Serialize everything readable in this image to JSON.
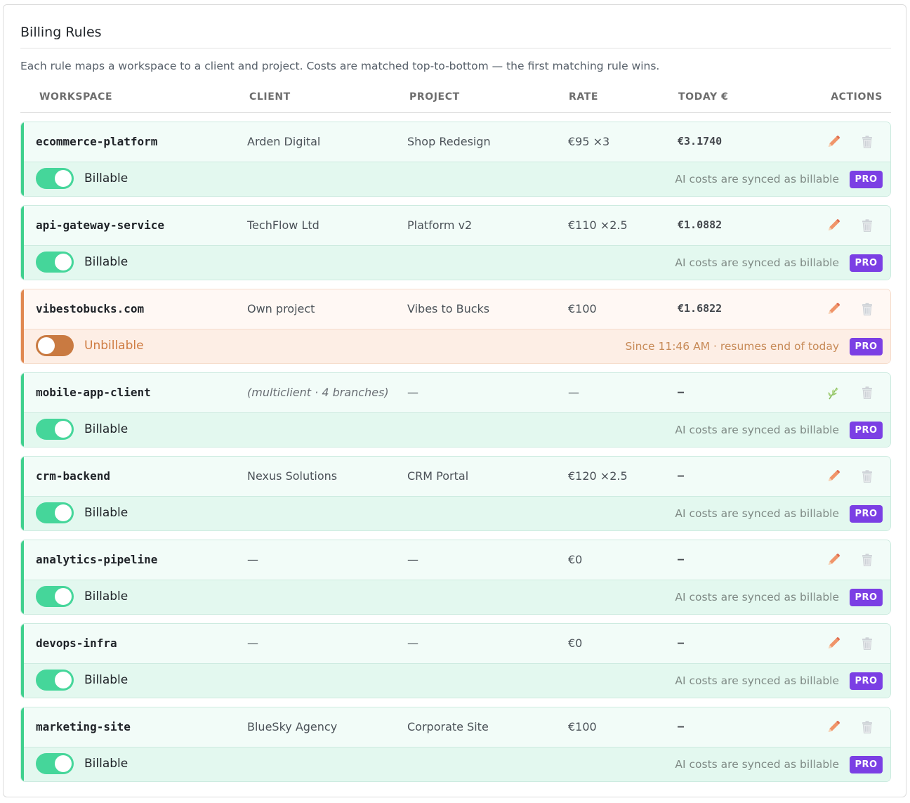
{
  "header": {
    "title": "Billing Rules",
    "description": "Each rule maps a workspace to a client and project. Costs are matched top-to-bottom — the first matching rule wins."
  },
  "columns": {
    "workspace": "WORKSPACE",
    "client": "CLIENT",
    "project": "PROJECT",
    "rate": "RATE",
    "today": "TODAY €",
    "actions": "ACTIONS"
  },
  "colors": {
    "billable_accent": "#3fd08d",
    "unbillable_accent": "#e08850",
    "pro_badge": "#7b3fe4",
    "edit_icon": "#f0956a"
  },
  "rules": [
    {
      "workspace": "ecommerce-platform",
      "client": "Arden Digital",
      "project": "Shop Redesign",
      "rate": "€95 ×3",
      "today": "€3.1740",
      "billable": true,
      "state_label": "Billable",
      "note": "AI costs are synced as billable",
      "badge": "PRO",
      "edit_icon": "pencil-icon",
      "delete_icon": "trash-icon"
    },
    {
      "workspace": "api-gateway-service",
      "client": "TechFlow Ltd",
      "project": "Platform v2",
      "rate": "€110 ×2.5",
      "today": "€1.0882",
      "billable": true,
      "state_label": "Billable",
      "note": "AI costs are synced as billable",
      "badge": "PRO",
      "edit_icon": "pencil-icon",
      "delete_icon": "trash-icon"
    },
    {
      "workspace": "vibestobucks.com",
      "client": "Own project",
      "project": "Vibes to Bucks",
      "rate": "€100",
      "today": "€1.6822",
      "billable": false,
      "state_label": "Unbillable",
      "note": "Since 11:46 AM · resumes end of today",
      "badge": "PRO",
      "edit_icon": "pencil-icon",
      "delete_icon": "trash-icon"
    },
    {
      "workspace": "mobile-app-client",
      "client": "(multiclient · 4 branches)",
      "project": "—",
      "rate": "—",
      "today": "–",
      "billable": true,
      "state_label": "Billable",
      "note": "AI costs are synced as billable",
      "badge": "PRO",
      "edit_icon": "branch-icon",
      "delete_icon": "trash-icon"
    },
    {
      "workspace": "crm-backend",
      "client": "Nexus Solutions",
      "project": "CRM Portal",
      "rate": "€120 ×2.5",
      "today": "–",
      "billable": true,
      "state_label": "Billable",
      "note": "AI costs are synced as billable",
      "badge": "PRO",
      "edit_icon": "pencil-icon",
      "delete_icon": "trash-icon"
    },
    {
      "workspace": "analytics-pipeline",
      "client": "—",
      "project": "—",
      "rate": "€0",
      "today": "–",
      "billable": true,
      "state_label": "Billable",
      "note": "AI costs are synced as billable",
      "badge": "PRO",
      "edit_icon": "pencil-icon",
      "delete_icon": "trash-icon"
    },
    {
      "workspace": "devops-infra",
      "client": "—",
      "project": "—",
      "rate": "€0",
      "today": "–",
      "billable": true,
      "state_label": "Billable",
      "note": "AI costs are synced as billable",
      "badge": "PRO",
      "edit_icon": "pencil-icon",
      "delete_icon": "trash-icon"
    },
    {
      "workspace": "marketing-site",
      "client": "BlueSky Agency",
      "project": "Corporate Site",
      "rate": "€100",
      "today": "–",
      "billable": true,
      "state_label": "Billable",
      "note": "AI costs are synced as billable",
      "badge": "PRO",
      "edit_icon": "pencil-icon",
      "delete_icon": "trash-icon"
    }
  ]
}
